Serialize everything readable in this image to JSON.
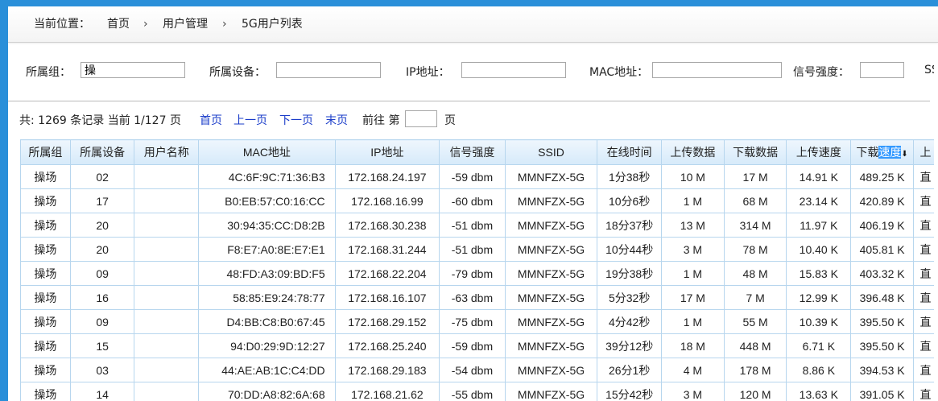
{
  "breadcrumb": {
    "label": "当前位置：",
    "home": "首页",
    "sep": "›",
    "level1": "用户管理",
    "level2": "5G用户列表"
  },
  "filters": {
    "group_label": "所属组：",
    "group_value": "操",
    "device_label": "所属设备：",
    "ip_label": "IP地址：",
    "mac_label": "MAC地址：",
    "signal_label": "信号强度：",
    "ssid_label_partial": "SS"
  },
  "pager": {
    "summary": "共: 1269 条记录 当前 1/127 页",
    "first": "首页",
    "prev": "上一页",
    "next": "下一页",
    "last": "末页",
    "goto_prefix": "前往 第",
    "goto_suffix": "页"
  },
  "table": {
    "headers": [
      "所属组",
      "所属设备",
      "用户名称",
      "MAC地址",
      "IP地址",
      "信号强度",
      "SSID",
      "在线时间",
      "上传数据",
      "下载数据",
      "上传速度"
    ],
    "download_speed_header_a": "下载",
    "download_speed_header_b": "速度",
    "sort_icon": "⬇",
    "last_header_partial": "上",
    "rows": [
      [
        "操场",
        "02",
        "",
        "4C:6F:9C:71:36:B3",
        "172.168.24.197",
        "-59 dbm",
        "MMNFZX-5G",
        "1分38秒",
        "10 M",
        "17 M",
        "14.91 K",
        "489.25 K",
        "直"
      ],
      [
        "操场",
        "17",
        "",
        "B0:EB:57:C0:16:CC",
        "172.168.16.99",
        "-60 dbm",
        "MMNFZX-5G",
        "10分6秒",
        "1 M",
        "68 M",
        "23.14 K",
        "420.89 K",
        "直"
      ],
      [
        "操场",
        "20",
        "",
        "30:94:35:CC:D8:2B",
        "172.168.30.238",
        "-51 dbm",
        "MMNFZX-5G",
        "18分37秒",
        "13 M",
        "314 M",
        "11.97 K",
        "406.19 K",
        "直"
      ],
      [
        "操场",
        "20",
        "",
        "F8:E7:A0:8E:E7:E1",
        "172.168.31.244",
        "-51 dbm",
        "MMNFZX-5G",
        "10分44秒",
        "3 M",
        "78 M",
        "10.40 K",
        "405.81 K",
        "直"
      ],
      [
        "操场",
        "09",
        "",
        "48:FD:A3:09:BD:F5",
        "172.168.22.204",
        "-79 dbm",
        "MMNFZX-5G",
        "19分38秒",
        "1 M",
        "48 M",
        "15.83 K",
        "403.32 K",
        "直"
      ],
      [
        "操场",
        "16",
        "",
        "58:85:E9:24:78:77",
        "172.168.16.107",
        "-63 dbm",
        "MMNFZX-5G",
        "5分32秒",
        "17 M",
        "7 M",
        "12.99 K",
        "396.48 K",
        "直"
      ],
      [
        "操场",
        "09",
        "",
        "D4:BB:C8:B0:67:45",
        "172.168.29.152",
        "-75 dbm",
        "MMNFZX-5G",
        "4分42秒",
        "1 M",
        "55 M",
        "10.39 K",
        "395.50 K",
        "直"
      ],
      [
        "操场",
        "15",
        "",
        "94:D0:29:9D:12:27",
        "172.168.25.240",
        "-59 dbm",
        "MMNFZX-5G",
        "39分12秒",
        "18 M",
        "448 M",
        "6.71 K",
        "395.50 K",
        "直"
      ],
      [
        "操场",
        "03",
        "",
        "44:AE:AB:1C:C4:DD",
        "172.168.29.183",
        "-54 dbm",
        "MMNFZX-5G",
        "26分1秒",
        "4 M",
        "178 M",
        "8.86 K",
        "394.53 K",
        "直"
      ],
      [
        "操场",
        "14",
        "",
        "70:DD:A8:82:6A:68",
        "172.168.21.62",
        "-55 dbm",
        "MMNFZX-5G",
        "15分42秒",
        "3 M",
        "120 M",
        "13.63 K",
        "391.05 K",
        "直"
      ]
    ]
  }
}
